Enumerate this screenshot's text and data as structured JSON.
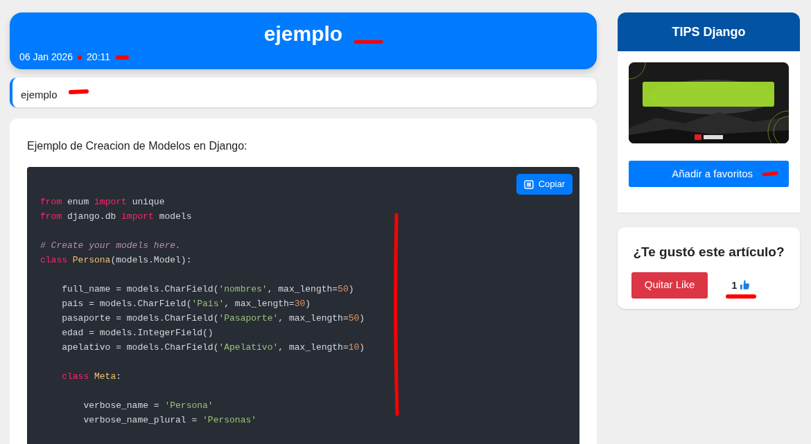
{
  "post": {
    "title": "ejemplo",
    "date": "06 Jan 2026",
    "time": "20:11",
    "summary": "ejemplo",
    "intro": "Ejemplo de Creacion de Modelos en Django:"
  },
  "code": {
    "copy_button": "Copiar",
    "lines": [
      {
        "tokens": [
          {
            "kind": "keyword",
            "text": "from"
          },
          {
            "kind": "plain",
            "text": " enum "
          },
          {
            "kind": "keyword",
            "text": "import"
          },
          {
            "kind": "plain",
            "text": " unique"
          }
        ]
      },
      {
        "tokens": [
          {
            "kind": "keyword",
            "text": "from"
          },
          {
            "kind": "plain",
            "text": " django.db "
          },
          {
            "kind": "keyword",
            "text": "import"
          },
          {
            "kind": "plain",
            "text": " models"
          }
        ]
      },
      {
        "kind": "blank"
      },
      {
        "tokens": [
          {
            "kind": "comment",
            "text": "# Create your models here."
          }
        ]
      },
      {
        "tokens": [
          {
            "kind": "keyword",
            "text": "class"
          },
          {
            "kind": "class",
            "text": " Persona"
          },
          {
            "kind": "plain",
            "text": "(models.Model):"
          }
        ]
      },
      {
        "kind": "blank"
      },
      {
        "tokens": [
          {
            "kind": "plain",
            "text": "    full_name = models.CharField("
          },
          {
            "kind": "string",
            "text": "'nombres'"
          },
          {
            "kind": "plain",
            "text": ", max_length="
          },
          {
            "kind": "number",
            "text": "50"
          },
          {
            "kind": "plain",
            "text": ")"
          }
        ]
      },
      {
        "tokens": [
          {
            "kind": "plain",
            "text": "    pais = models.CharField("
          },
          {
            "kind": "string",
            "text": "'Pais'"
          },
          {
            "kind": "plain",
            "text": ", max_length="
          },
          {
            "kind": "number",
            "text": "30"
          },
          {
            "kind": "plain",
            "text": ")"
          }
        ]
      },
      {
        "tokens": [
          {
            "kind": "plain",
            "text": "    pasaporte = models.CharField("
          },
          {
            "kind": "string",
            "text": "'Pasaporte'"
          },
          {
            "kind": "plain",
            "text": ", max_length="
          },
          {
            "kind": "number",
            "text": "50"
          },
          {
            "kind": "plain",
            "text": ")"
          }
        ]
      },
      {
        "tokens": [
          {
            "kind": "plain",
            "text": "    edad = models.IntegerField()"
          }
        ]
      },
      {
        "tokens": [
          {
            "kind": "plain",
            "text": "    apelativo = models.CharField("
          },
          {
            "kind": "string",
            "text": "'Apelativo'"
          },
          {
            "kind": "plain",
            "text": ", max_length="
          },
          {
            "kind": "number",
            "text": "10"
          },
          {
            "kind": "plain",
            "text": ")"
          }
        ]
      },
      {
        "kind": "blank"
      },
      {
        "tokens": [
          {
            "kind": "keyword",
            "text": "    class"
          },
          {
            "kind": "class",
            "text": " Meta"
          },
          {
            "kind": "plain",
            "text": ":"
          }
        ]
      },
      {
        "kind": "blank"
      },
      {
        "tokens": [
          {
            "kind": "plain",
            "text": "        verbose_name = "
          },
          {
            "kind": "string",
            "text": "'Persona'"
          }
        ]
      },
      {
        "tokens": [
          {
            "kind": "plain",
            "text": "        verbose_name_plural = "
          },
          {
            "kind": "string",
            "text": "'Personas'"
          }
        ]
      }
    ]
  },
  "sidebar": {
    "title": "TIPS Django",
    "favorite_button": "Añadir a favoritos"
  },
  "like_box": {
    "question": "¿Te gustó este artículo?",
    "unlike_button": "Quitar Like",
    "count": "1"
  }
}
